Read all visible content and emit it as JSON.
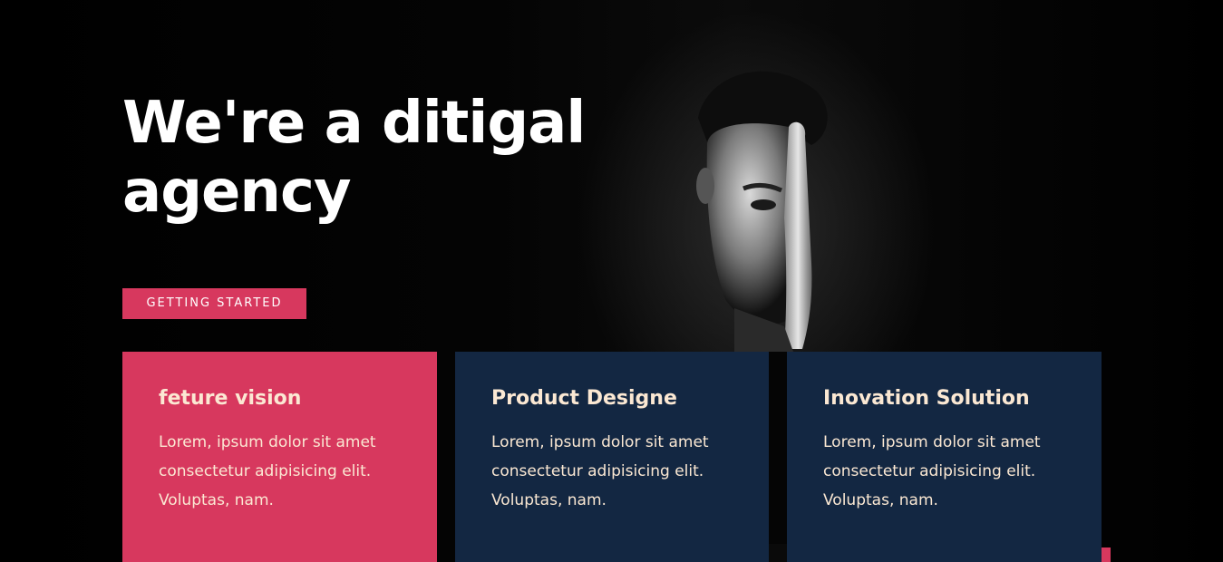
{
  "hero": {
    "title": "We're a ditigal agency",
    "cta_label": "GETTING  STARTED"
  },
  "cards": [
    {
      "title": "feture vision",
      "text": "Lorem, ipsum dolor sit amet consectetur adipisicing elit. Voluptas, nam."
    },
    {
      "title": "Product Designe",
      "text": "Lorem, ipsum dolor sit amet consectetur adipisicing elit. Voluptas, nam."
    },
    {
      "title": "Inovation Solution",
      "text": "Lorem, ipsum dolor sit amet consectetur adipisicing elit. Voluptas, nam."
    }
  ],
  "colors": {
    "background": "#000000",
    "accent": "#d7385e",
    "navy": "#132742",
    "card_text": "#fbe8d3"
  }
}
